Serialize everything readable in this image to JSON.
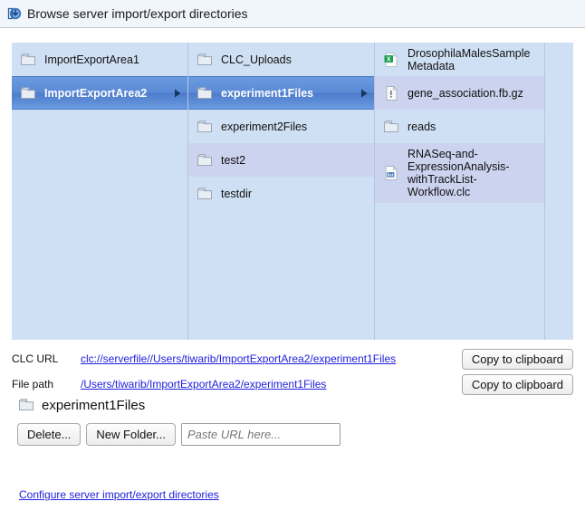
{
  "window": {
    "title": "Browse server import/export directories",
    "title_icon": "import-export-arrow-icon"
  },
  "browser": {
    "columns": [
      {
        "name": "column-areas",
        "items": [
          {
            "label": "ImportExportArea1",
            "icon": "folder-icon",
            "selected": false,
            "has_children": false,
            "alt": false
          },
          {
            "label": "ImportExportArea2",
            "icon": "folder-icon",
            "selected": true,
            "has_children": true,
            "alt": true
          }
        ]
      },
      {
        "name": "column-folders",
        "items": [
          {
            "label": "CLC_Uploads",
            "icon": "folder-icon",
            "selected": false,
            "has_children": false,
            "alt": false
          },
          {
            "label": "experiment1Files",
            "icon": "folder-icon",
            "selected": true,
            "has_children": true,
            "alt": true
          },
          {
            "label": "experiment2Files",
            "icon": "folder-icon",
            "selected": false,
            "has_children": false,
            "alt": false
          },
          {
            "label": "test2",
            "icon": "folder-icon",
            "selected": false,
            "has_children": false,
            "alt": true
          },
          {
            "label": "testdir",
            "icon": "folder-icon",
            "selected": false,
            "has_children": false,
            "alt": false
          }
        ]
      },
      {
        "name": "column-files",
        "items": [
          {
            "label": "DrosophilaMalesSampleMetadata",
            "icon": "excel-file-icon",
            "selected": false,
            "has_children": false,
            "alt": false
          },
          {
            "label": "gene_association.fb.gz",
            "icon": "generic-file-icon",
            "selected": false,
            "has_children": false,
            "alt": true
          },
          {
            "label": "reads",
            "icon": "folder-icon",
            "selected": false,
            "has_children": false,
            "alt": false
          },
          {
            "label": "RNASeq-and-ExpressionAnalysis-withTrackList-Workflow.clc",
            "icon": "workflow-file-icon",
            "selected": false,
            "has_children": false,
            "alt": true,
            "tall": true
          }
        ]
      },
      {
        "name": "column-empty",
        "items": []
      }
    ]
  },
  "paths": {
    "clc_url_label": "CLC URL",
    "clc_url_value": "clc://serverfile//Users/tiwarib/ImportExportArea2/experiment1Files",
    "file_path_label": "File path",
    "file_path_value": "/Users/tiwarib/ImportExportArea2/experiment1Files",
    "copy_button_label": "Copy to clipboard"
  },
  "current_folder": {
    "name": "experiment1Files",
    "icon": "folder-icon"
  },
  "actions": {
    "delete_label": "Delete...",
    "new_folder_label": "New Folder...",
    "url_input_value": "",
    "url_input_placeholder": "Paste URL here..."
  },
  "footer": {
    "configure_link": "Configure server import/export directories"
  },
  "colors": {
    "panel_bg": "#cfe0f4",
    "row_alt_bg": "#ccd3ee",
    "selection": "#5b8ad6",
    "link": "#2020dd",
    "titlebar_bg": "#f1f5fc"
  }
}
